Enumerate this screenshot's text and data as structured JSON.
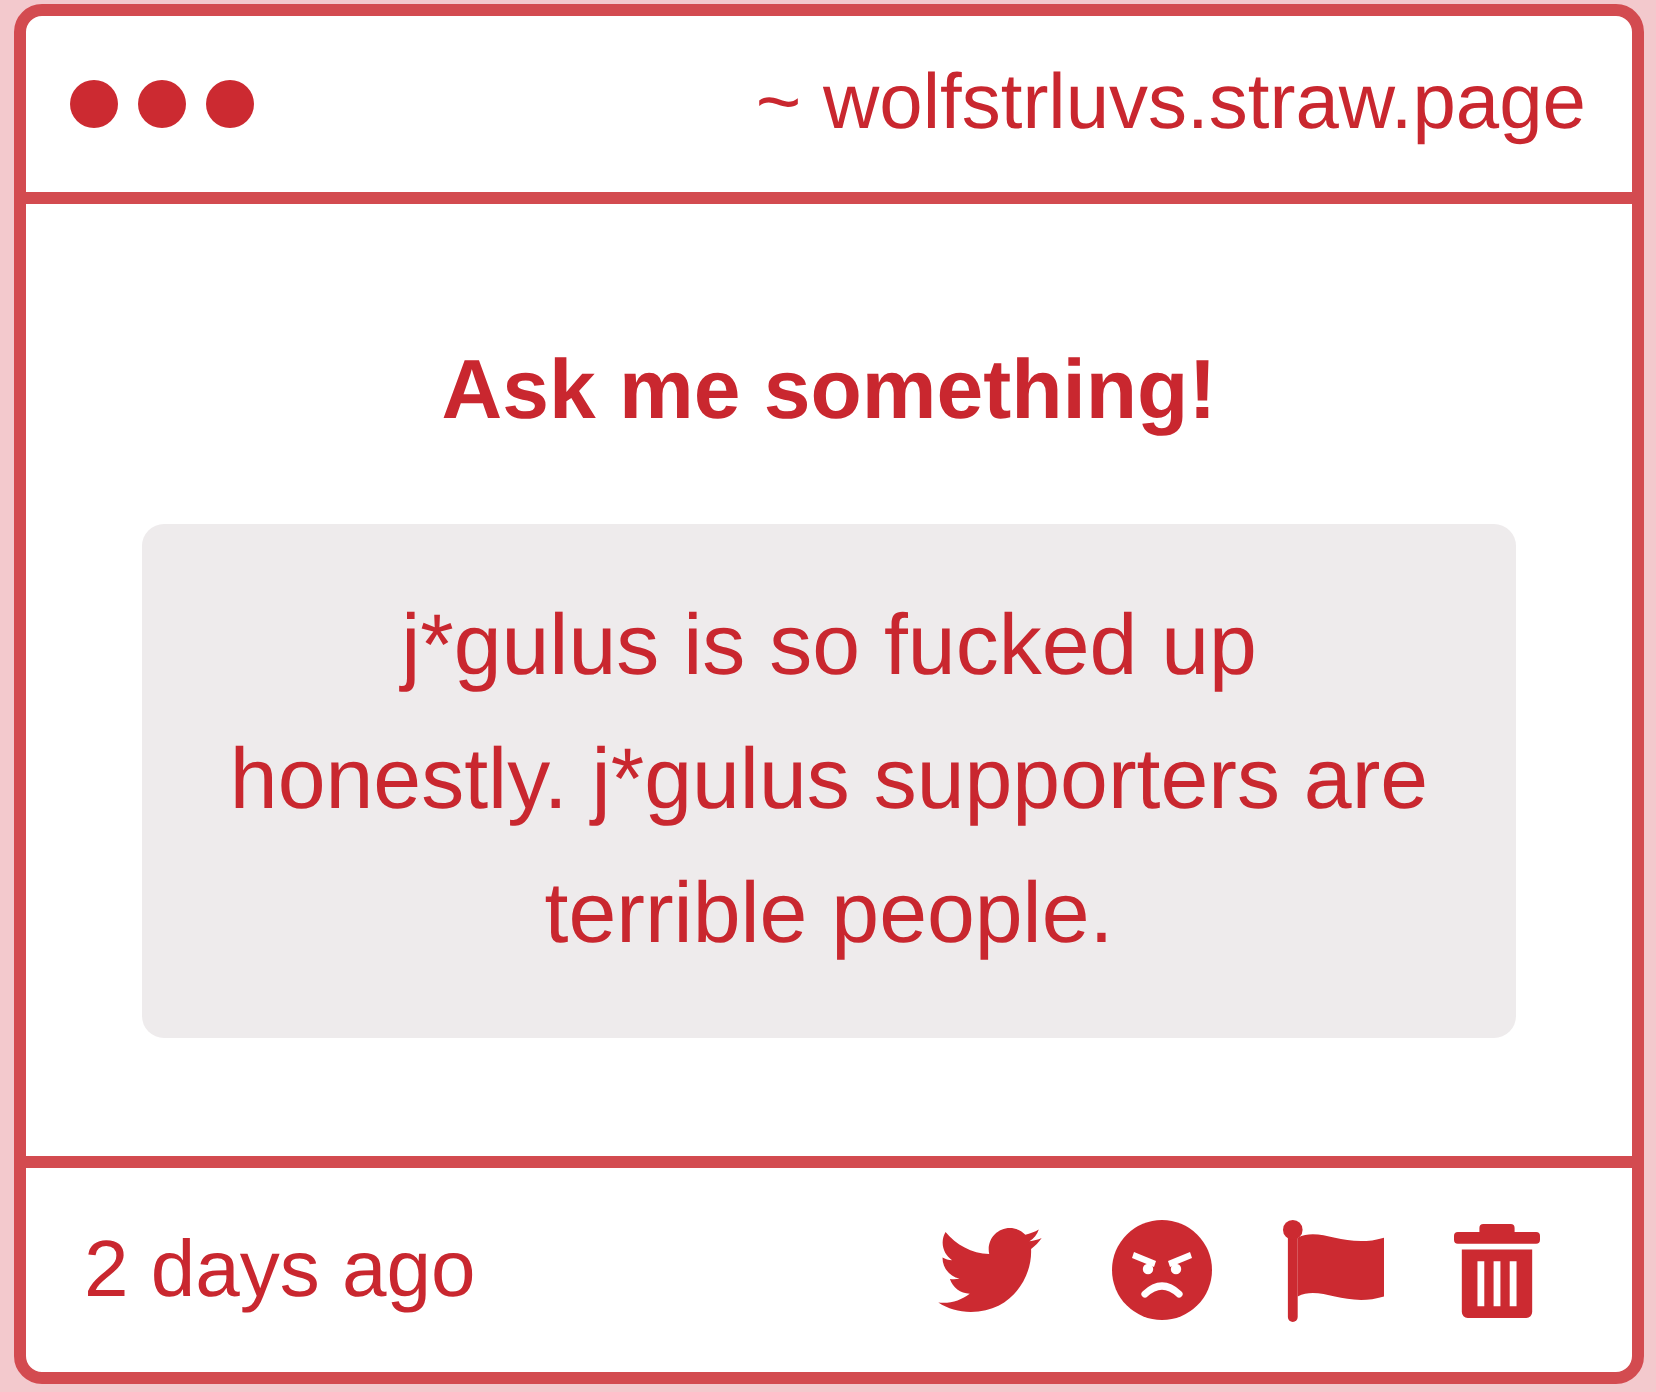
{
  "header": {
    "url": "~ wolfstrluvs.straw.page"
  },
  "prompt": "Ask me something!",
  "question": "j*gulus is so fucked up honestly. j*gulus supporters are terrible people.",
  "footer": {
    "timestamp": "2 days ago"
  }
}
